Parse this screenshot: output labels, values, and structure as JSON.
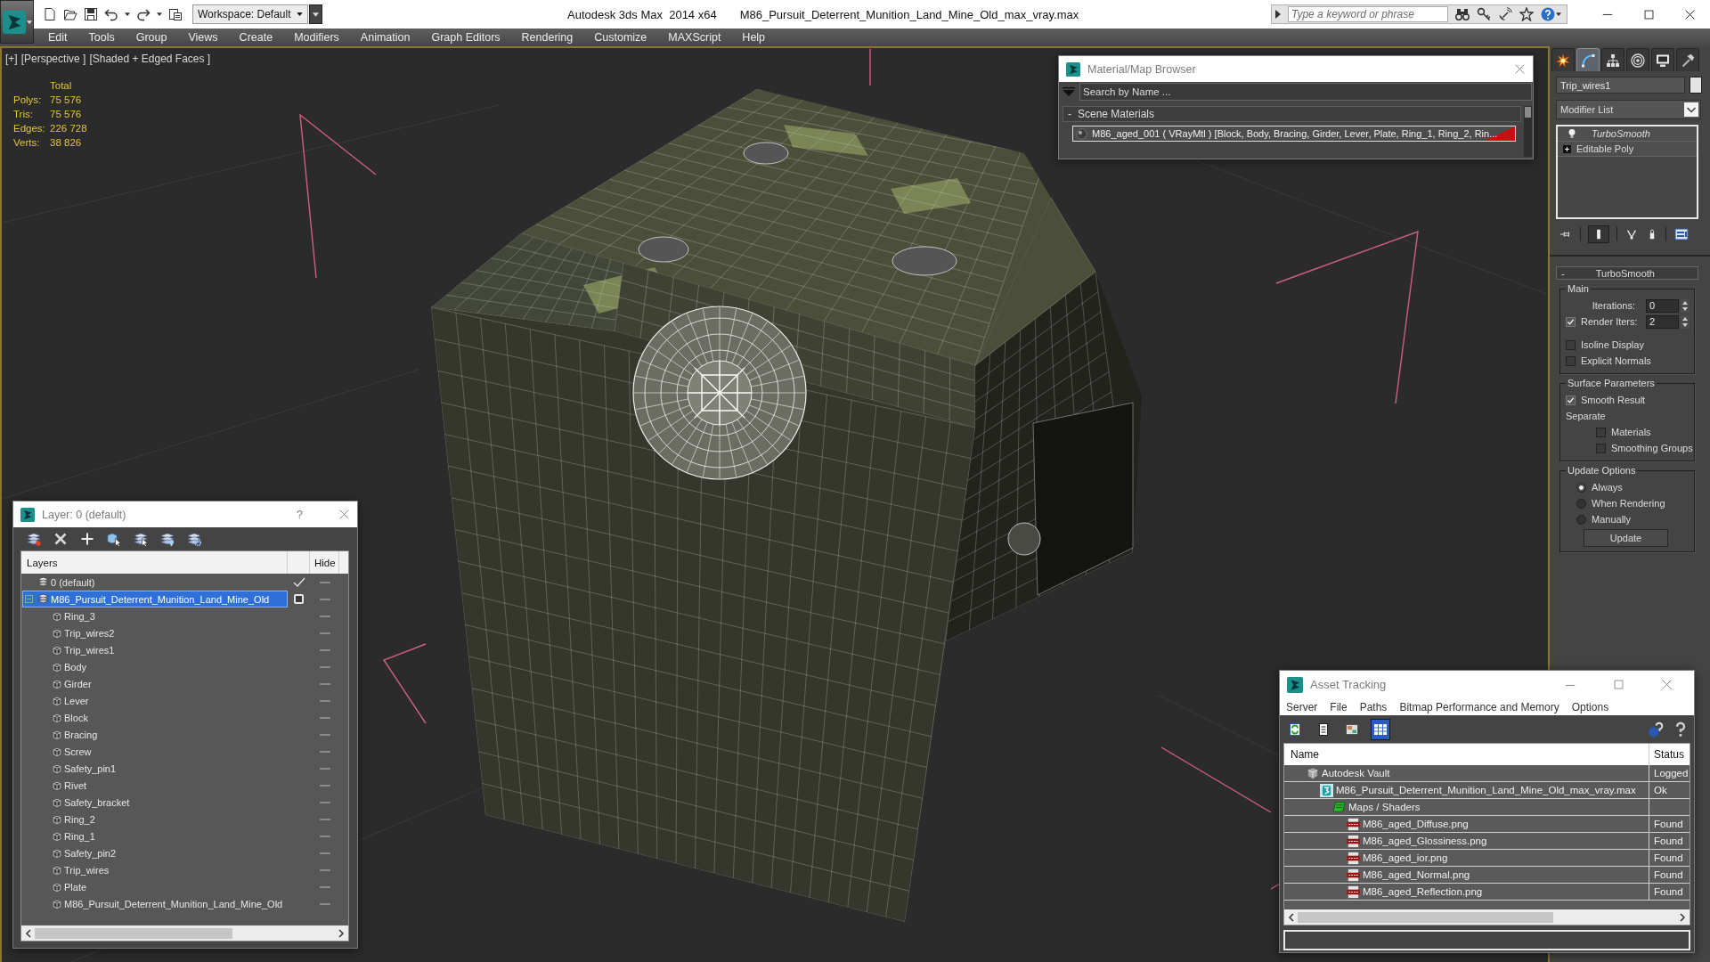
{
  "window": {
    "app_title": "Autodesk 3ds Max  2014 x64",
    "file_title": "M86_Pursuit_Deterrent_Munition_Land_Mine_Old_max_vray.max"
  },
  "quick_access": {
    "workspace": "Workspace: Default"
  },
  "info_center": {
    "search": {
      "placeholder": "Type a keyword or phrase"
    }
  },
  "menu": [
    "Edit",
    "Tools",
    "Group",
    "Views",
    "Create",
    "Modifiers",
    "Animation",
    "Graph Editors",
    "Rendering",
    "Customize",
    "MAXScript",
    "Help"
  ],
  "viewport": {
    "labels": [
      "[+]",
      "[Perspective ]",
      "[Shaded + Edged Faces ]"
    ],
    "stats": {
      "header": "Total",
      "rows": [
        {
          "label": "Polys:",
          "value": "75 576"
        },
        {
          "label": "Tris:",
          "value": "75 576"
        },
        {
          "label": "Edges:",
          "value": "226 728"
        },
        {
          "label": "Verts:",
          "value": "38 826"
        }
      ]
    }
  },
  "material_browser": {
    "title": "Material/Map Browser",
    "search": {
      "placeholder": "Search by Name ..."
    },
    "groups": [
      {
        "toggle": "-",
        "label": "Scene Materials",
        "materials": [
          {
            "name": "M86_aged_001 ( VRayMtl ) [Block, Body, Bracing, Girder, Lever, Plate, Ring_1, Ring_2, Rin...",
            "selected": true
          }
        ]
      }
    ]
  },
  "layer_manager": {
    "title": "Layer: 0 (default)",
    "help": "?",
    "columns": [
      "Layers",
      "Hide"
    ],
    "layers": [
      {
        "name": "0 (default)",
        "current": true,
        "selected": false
      },
      {
        "name": "M86_Pursuit_Deterrent_Munition_Land_Mine_Old",
        "current": false,
        "selected": true,
        "expanded": true,
        "children": [
          {
            "name": "Ring_3",
            "selected": false
          },
          {
            "name": "Trip_wires2",
            "selected": false
          },
          {
            "name": "Trip_wires1",
            "selected": false
          },
          {
            "name": "Body",
            "selected": false
          },
          {
            "name": "Girder",
            "selected": false
          },
          {
            "name": "Lever",
            "selected": false
          },
          {
            "name": "Block",
            "selected": false
          },
          {
            "name": "Bracing",
            "selected": false
          },
          {
            "name": "Screw",
            "selected": false
          },
          {
            "name": "Safety_pin1",
            "selected": false
          },
          {
            "name": "Rivet",
            "selected": false
          },
          {
            "name": "Safety_bracket",
            "selected": false
          },
          {
            "name": "Ring_2",
            "selected": false
          },
          {
            "name": "Ring_1",
            "selected": false
          },
          {
            "name": "Safety_pin2",
            "selected": false
          },
          {
            "name": "Trip_wires",
            "selected": false
          },
          {
            "name": "Plate",
            "selected": false
          },
          {
            "name": "M86_Pursuit_Deterrent_Munition_Land_Mine_Old",
            "selected": false
          }
        ]
      }
    ]
  },
  "command_panel": {
    "tabs": [
      {
        "kind": "create",
        "selected": false
      },
      {
        "kind": "modify",
        "selected": true
      },
      {
        "kind": "hierarchy",
        "selected": false
      },
      {
        "kind": "motion",
        "selected": false
      },
      {
        "kind": "display",
        "selected": false
      },
      {
        "kind": "utilities",
        "selected": false
      }
    ],
    "object_name": "Trip_wires1",
    "modifier_list": "Modifier List",
    "stack": [
      {
        "kind": "modifier",
        "name": "TurboSmooth",
        "on": true
      },
      {
        "kind": "base",
        "name": "Editable Poly",
        "expanded": false
      }
    ],
    "stack_tools": [
      {
        "kind": "pin",
        "on": false
      },
      {
        "kind": "end_result",
        "on": true
      },
      {
        "kind": "make_unique",
        "on": false
      },
      {
        "kind": "remove",
        "on": false
      },
      {
        "kind": "configure",
        "on": false
      }
    ],
    "rollout": {
      "toggle": "-",
      "title": "TurboSmooth",
      "groups": [
        {
          "title": "Main",
          "controls": [
            {
              "kind": "spinner",
              "label": "Iterations:",
              "value": "0"
            },
            {
              "kind": "check_spinner",
              "label": "Render Iters:",
              "checked": true,
              "value": "2"
            },
            {
              "kind": "checkbox",
              "label": "Isoline Display",
              "checked": false
            },
            {
              "kind": "checkbox",
              "label": "Explicit Normals",
              "checked": false
            }
          ]
        },
        {
          "title": "Surface Parameters",
          "controls": [
            {
              "kind": "checkbox",
              "label": "Smooth Result",
              "checked": true
            },
            {
              "kind": "label",
              "label": "Separate"
            },
            {
              "kind": "sub_checkbox",
              "label": "Materials",
              "checked": false
            },
            {
              "kind": "sub_checkbox",
              "label": "Smoothing Groups",
              "checked": false
            }
          ]
        },
        {
          "title": "Update Options",
          "controls": [
            {
              "kind": "radio",
              "label": "Always",
              "selected": true
            },
            {
              "kind": "radio",
              "label": "When Rendering",
              "selected": false
            },
            {
              "kind": "radio",
              "label": "Manually",
              "selected": false
            },
            {
              "kind": "button",
              "label": "Update"
            }
          ]
        }
      ]
    }
  },
  "asset_tracking": {
    "title": "Asset Tracking",
    "menu": [
      "Server",
      "File",
      "Paths",
      "Bitmap Performance and Memory",
      "Options"
    ],
    "toolbar": [
      {
        "kind": "refresh",
        "selected": false
      },
      {
        "kind": "list",
        "selected": false
      },
      {
        "kind": "thumbnails",
        "selected": false
      },
      {
        "kind": "table",
        "selected": true
      }
    ],
    "columns": [
      "Name",
      "Status"
    ],
    "assets": [
      {
        "kind": "vault",
        "name": "Autodesk Vault",
        "status": "Logged",
        "children": [
          {
            "kind": "scene",
            "name": "M86_Pursuit_Deterrent_Munition_Land_Mine_Old_max_vray.max",
            "status": "Ok",
            "children": [
              {
                "kind": "folder",
                "name": "Maps / Shaders",
                "children": [
                  {
                    "kind": "png",
                    "name": "M86_aged_Diffuse.png",
                    "status": "Found"
                  },
                  {
                    "kind": "png",
                    "name": "M86_aged_Glossiness.png",
                    "status": "Found"
                  },
                  {
                    "kind": "png",
                    "name": "M86_aged_ior.png",
                    "status": "Found"
                  },
                  {
                    "kind": "png",
                    "name": "M86_aged_Normal.png",
                    "status": "Found"
                  },
                  {
                    "kind": "png",
                    "name": "M86_aged_Reflection.png",
                    "status": "Found"
                  }
                ]
              }
            ]
          }
        ]
      }
    ]
  }
}
